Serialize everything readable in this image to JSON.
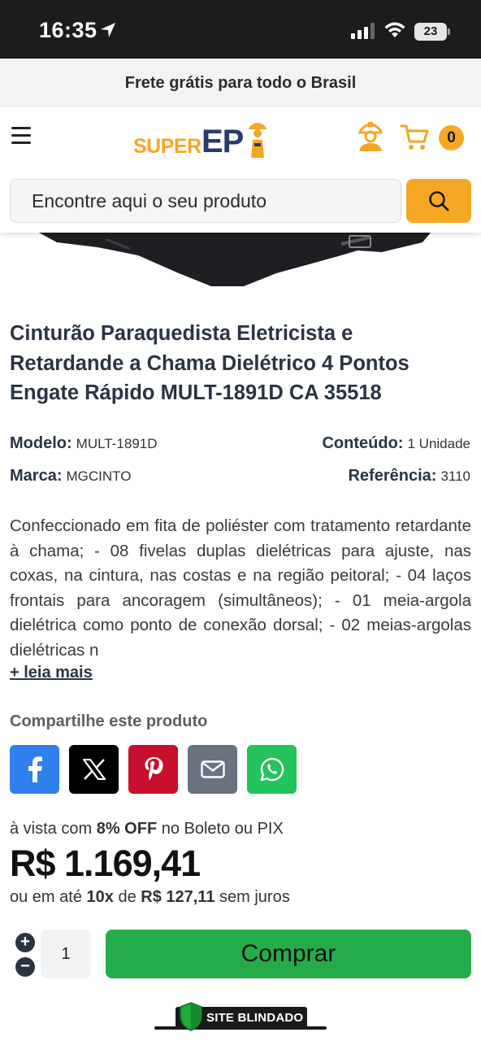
{
  "status_bar": {
    "time": "16:35",
    "battery": "23"
  },
  "promo": {
    "text": "Frete grátis para todo o Brasil"
  },
  "header": {
    "logo_super": "SUPER",
    "logo_ep": "EP",
    "cart_count": "0",
    "search_placeholder": "Encontre aqui o seu produto"
  },
  "product": {
    "title": "Cinturão Paraquedista Eletricista e Retardande a Chama Dielétrico 4 Pontos Engate Rápido MULT-1891D CA 35518",
    "specs": {
      "modelo_label": "Modelo:",
      "modelo_value": "MULT-1891D",
      "conteudo_label": "Conteúdo:",
      "conteudo_value": "1 Unidade",
      "marca_label": "Marca:",
      "marca_value": "MGCINTO",
      "referencia_label": "Referência:",
      "referencia_value": "3110"
    },
    "description": "Confeccionado em fita de poliéster com tratamento retardante à chama; - 08 fivelas duplas dielétricas para ajuste, nas coxas, na cintura, nas costas e na região peitoral; -  04 laços frontais para ancoragem (simultâneos); - 01 meia-argola dielétrica como ponto de conexão dorsal; - 02 meias-argolas dielétricas n",
    "read_more": "+ leia mais"
  },
  "share": {
    "title": "Compartilhe este produto",
    "buttons": [
      {
        "icon": "facebook-icon",
        "color": "#2f80ed"
      },
      {
        "icon": "x-icon",
        "color": "#000000"
      },
      {
        "icon": "pinterest-icon",
        "color": "#c8102e"
      },
      {
        "icon": "email-icon",
        "color": "#6b7280"
      },
      {
        "icon": "whatsapp-icon",
        "color": "#25c35c"
      }
    ]
  },
  "pricing": {
    "note_prefix": "à vista com ",
    "discount": "8% OFF",
    "note_suffix": " no Boleto ou PIX",
    "price": "R$ 1.169,41",
    "inst_prefix": "ou em até ",
    "inst_count": "10x",
    "inst_mid": " de ",
    "inst_value": "R$ 127,11",
    "inst_suffix": " sem juros"
  },
  "purchase": {
    "plus": "+",
    "minus": "−",
    "quantity": "1",
    "buy_label": "Comprar"
  },
  "badge": {
    "text": "SITE BLINDADO"
  },
  "colors": {
    "accent": "#f7a823",
    "brand_dark": "#2a3a6b",
    "buy_green": "#26ab4a"
  }
}
